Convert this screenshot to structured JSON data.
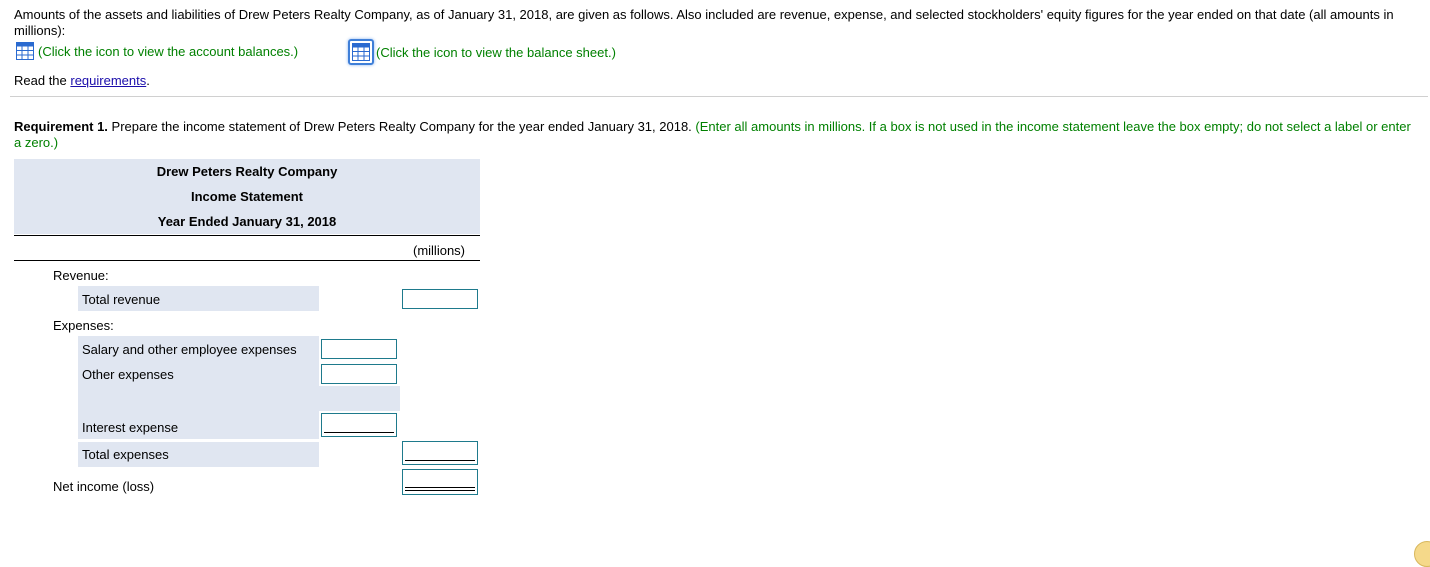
{
  "intro": {
    "text": "Amounts of the assets and liabilities of Drew Peters Realty Company, as of January 31, 2018, are given as follows. Also included are revenue, expense, and selected stockholders' equity figures for the year ended on that date (all amounts in millions):",
    "account_balances_link": "(Click the icon to view the account balances.)",
    "balance_sheet_link": "(Click the icon to view the balance sheet.)",
    "read_prefix": "Read the ",
    "requirements_link": "requirements",
    "read_suffix": "."
  },
  "requirement": {
    "label": "Requirement 1.",
    "text": " Prepare the income statement of Drew Peters Realty Company for the year ended January 31, 2018.",
    "instruction": " (Enter all amounts in millions. If a box is not used in the income statement leave the box empty; do not select a label or enter a zero.)"
  },
  "statement": {
    "company": "Drew Peters Realty Company",
    "title": "Income Statement",
    "period": "Year Ended January 31, 2018",
    "units": "(millions)",
    "revenue_heading": "Revenue:",
    "total_revenue_label": "Total revenue",
    "total_revenue_value": "",
    "expenses_heading": "Expenses:",
    "salary_label": "Salary and other employee expenses",
    "salary_value": "",
    "other_label": "Other expenses",
    "other_value": "",
    "blank_label": "",
    "interest_label": "Interest expense",
    "interest_value": "",
    "total_expenses_label": "Total expenses",
    "total_expenses_value": "",
    "net_income_label": "Net income (loss)",
    "net_income_value": ""
  },
  "colors": {
    "instruction_green": "#008000",
    "link_blue": "#1a0dab",
    "shade": "#e0e6f1",
    "input_border": "#1e7a8c"
  },
  "icons": {
    "account_balances": "table-grid-icon",
    "balance_sheet": "table-grid-icon"
  }
}
